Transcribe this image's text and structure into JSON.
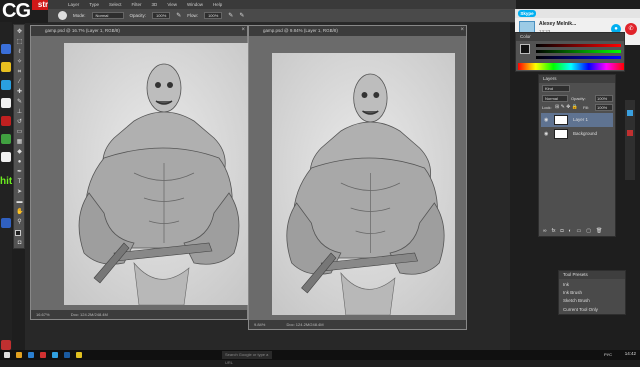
{
  "logo": {
    "cg": "CG",
    "stream": "stream"
  },
  "menu": [
    "Layer",
    "Type",
    "Select",
    "Filter",
    "3D",
    "View",
    "Window",
    "Help"
  ],
  "options": {
    "mode_label": "Mode:",
    "mode_value": "Normal",
    "opacity_label": "Opacity:",
    "opacity_value": "100%",
    "flow_label": "Flow:",
    "flow_value": "100%"
  },
  "desktop_left": {
    "hit_text": "hit"
  },
  "doc1": {
    "title": "gamp.psd @ 16.7% (Layer 1, RGB/8)",
    "zoom": "16.67%",
    "doc_info": "Doc: 124.2M/248.4M"
  },
  "doc2": {
    "title": "gamp.psd @ 9.84% (Layer 1, RGB/8)",
    "zoom": "9.84%",
    "doc_info": "Doc: 124.2M/248.4M"
  },
  "skype": {
    "logo": "Skype",
    "name": "Alexey Melnik...",
    "time": "13:23"
  },
  "color_panel": {
    "tab": "Color"
  },
  "layers": {
    "tab": "Layers",
    "kind": "Kind",
    "blend": "Normal",
    "opacity_label": "Opacity:",
    "opacity_value": "100%",
    "lock_label": "Lock:",
    "fill_label": "Fill:",
    "fill_value": "100%",
    "rows": [
      {
        "name": "Layer 1"
      },
      {
        "name": "Background"
      }
    ]
  },
  "tool_presets": {
    "tab": "Tool Presets",
    "items": [
      "Ink",
      "Ink Brush",
      "Sketch Brush",
      "Current Tool Only"
    ]
  },
  "taskbar": {
    "search": "Search Google or type a URL",
    "lang": "РУС",
    "clock": "14:42"
  },
  "colors": {
    "accent_red": "#d01818",
    "skype_blue": "#00aff0",
    "hangup_red": "#e0232a",
    "layer_selected": "#5f7391"
  }
}
